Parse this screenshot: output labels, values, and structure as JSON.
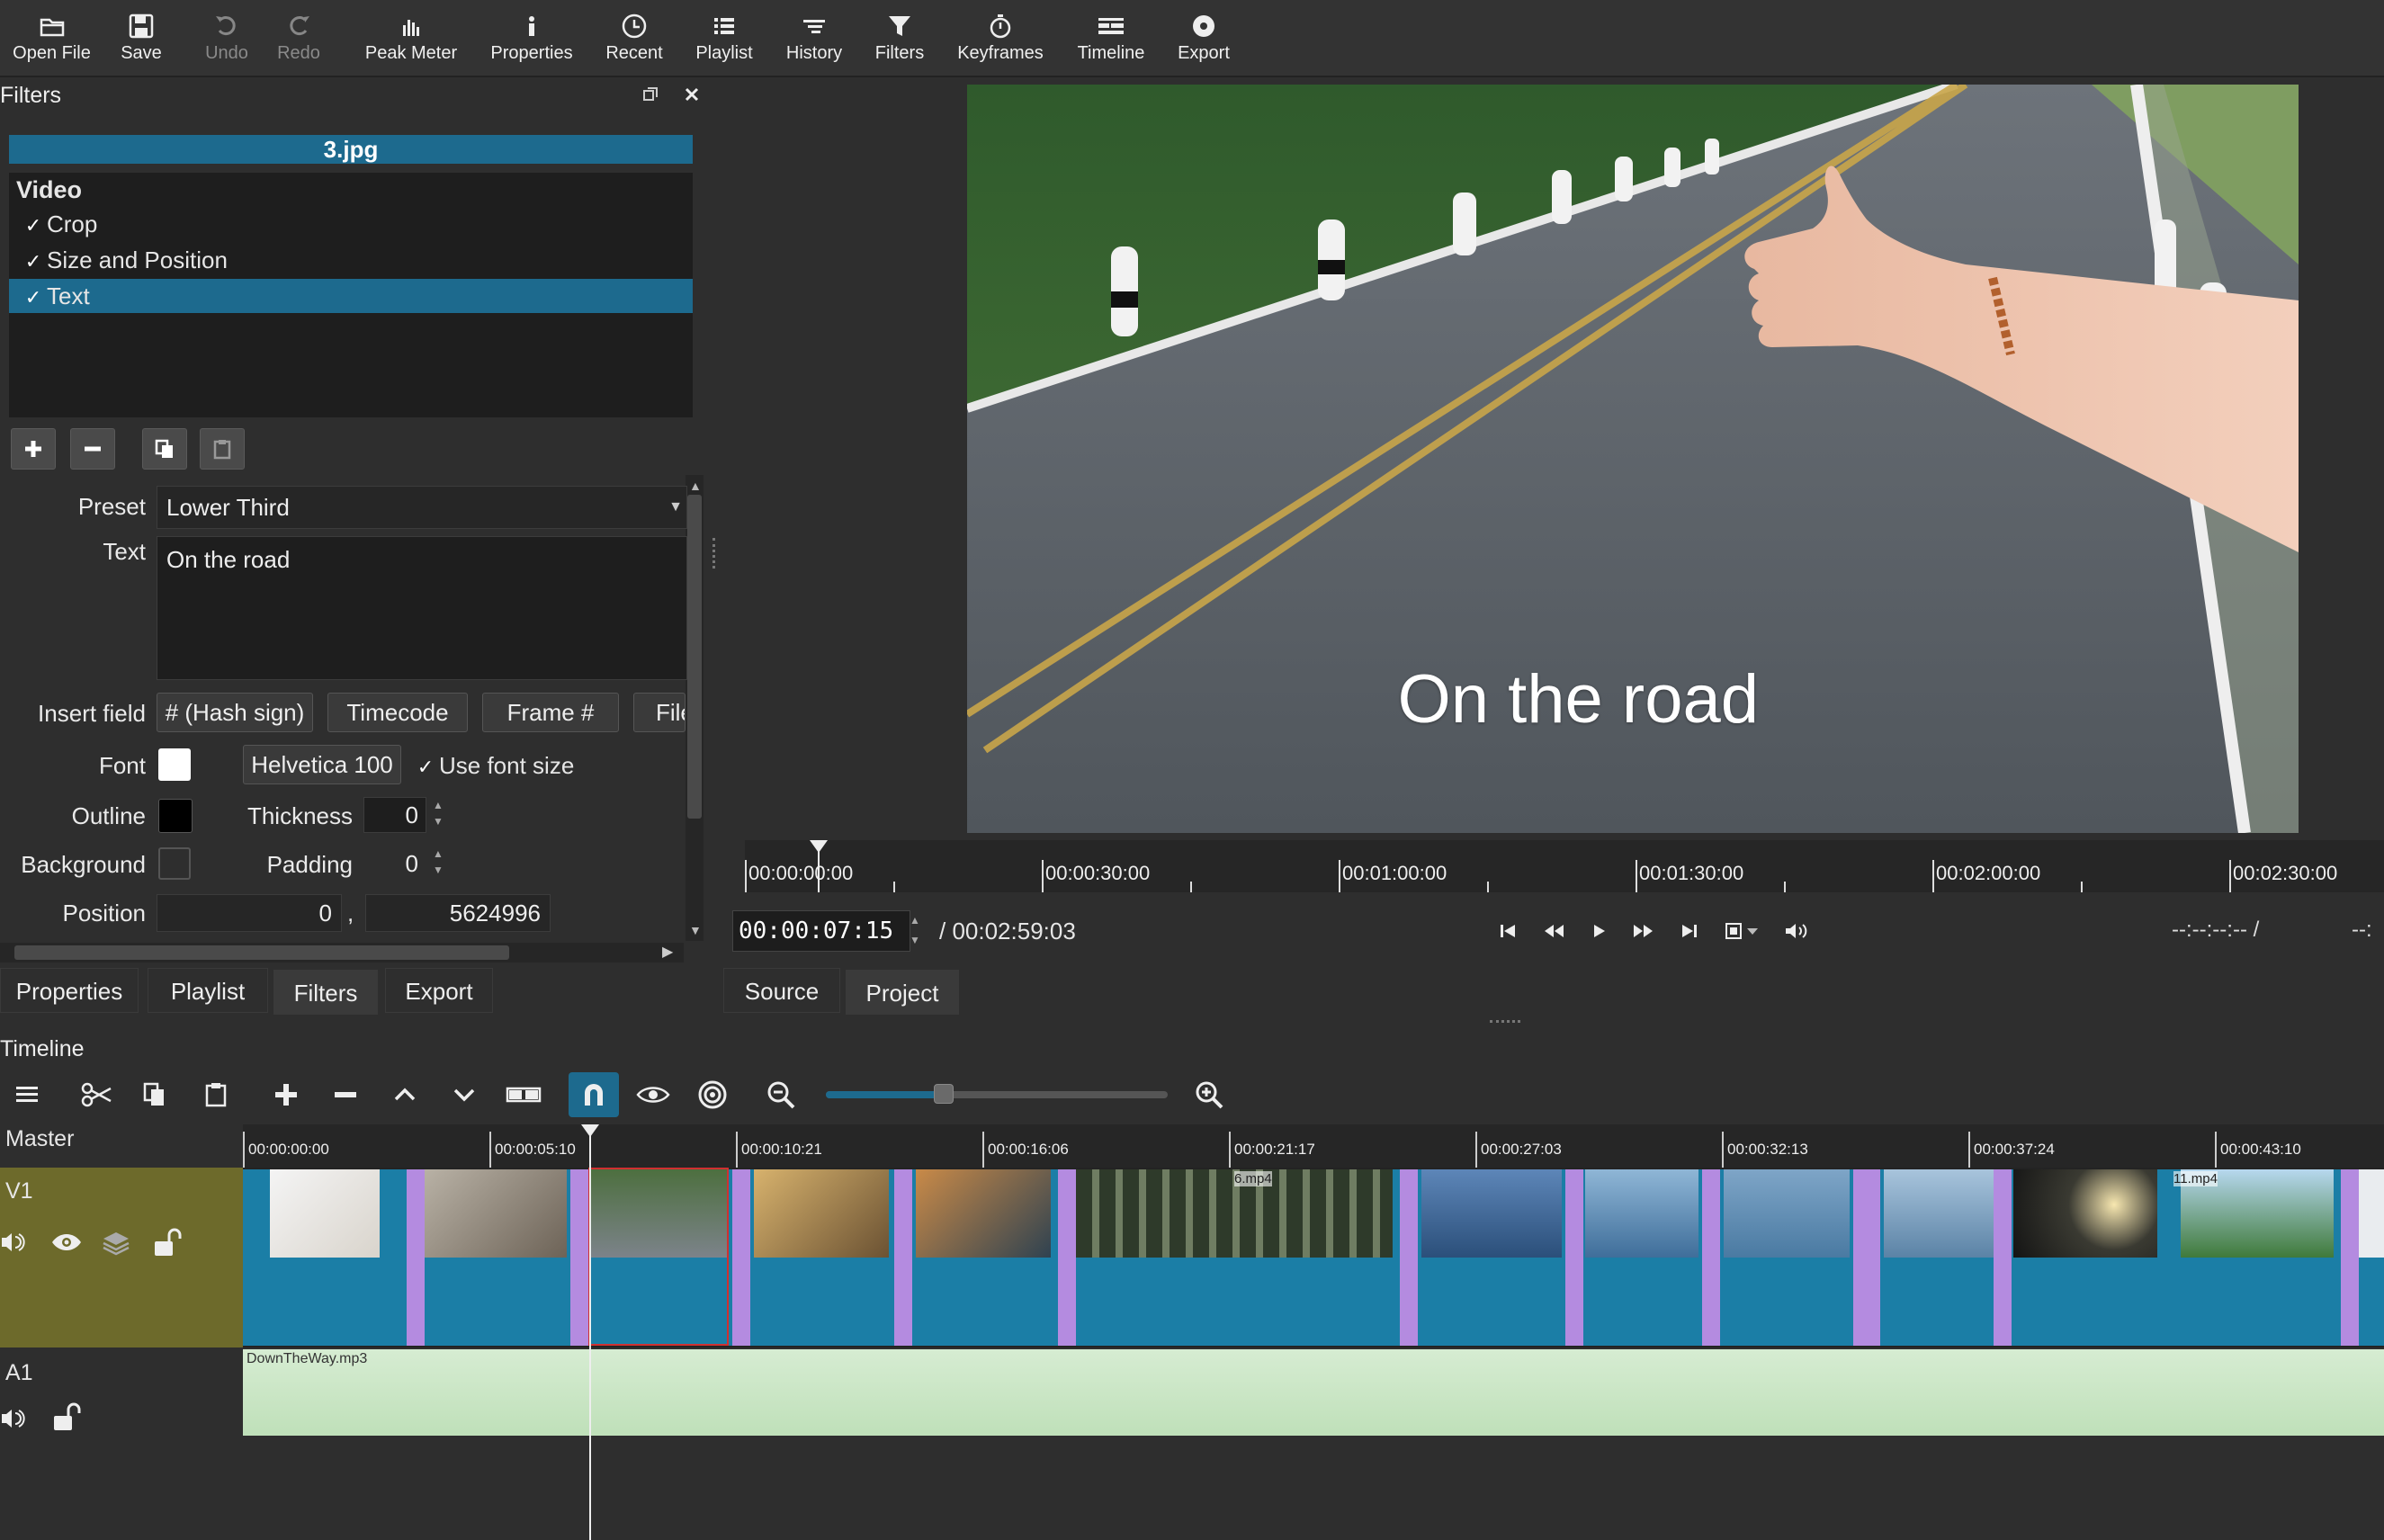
{
  "toolbar": {
    "items": [
      {
        "label": "Open File",
        "icon": "folder-icon"
      },
      {
        "label": "Save",
        "icon": "save-icon"
      },
      {
        "label": "Undo",
        "icon": "undo-icon",
        "disabled": true
      },
      {
        "label": "Redo",
        "icon": "redo-icon",
        "disabled": true
      },
      {
        "label": "Peak Meter",
        "icon": "peak-meter-icon"
      },
      {
        "label": "Properties",
        "icon": "info-icon"
      },
      {
        "label": "Recent",
        "icon": "clock-icon"
      },
      {
        "label": "Playlist",
        "icon": "list-icon"
      },
      {
        "label": "History",
        "icon": "history-icon"
      },
      {
        "label": "Filters",
        "icon": "funnel-icon"
      },
      {
        "label": "Keyframes",
        "icon": "stopwatch-icon"
      },
      {
        "label": "Timeline",
        "icon": "timeline-icon"
      },
      {
        "label": "Export",
        "icon": "export-icon"
      }
    ]
  },
  "filters": {
    "title": "Filters",
    "clip_name": "3.jpg",
    "group": "Video",
    "items": [
      {
        "label": "Crop",
        "checked": true
      },
      {
        "label": "Size and Position",
        "checked": true
      },
      {
        "label": "Text",
        "checked": true,
        "selected": true
      }
    ],
    "preset_label": "Preset",
    "preset_value": "Lower Third",
    "text_label": "Text",
    "text_value": "On the road",
    "insert_field_label": "Insert field",
    "insert_buttons": [
      "# (Hash sign)",
      "Timecode",
      "Frame #",
      "File"
    ],
    "font_label": "Font",
    "font_value": "Helvetica 100",
    "use_font_size": "Use font size",
    "outline_label": "Outline",
    "thickness_label": "Thickness",
    "thickness_value": "0",
    "background_label": "Background",
    "padding_label": "Padding",
    "padding_value": "0",
    "position_label": "Position",
    "position_x": "0",
    "position_sep": ",",
    "position_y": "5624996",
    "colors": {
      "font": "#ffffff",
      "outline": "#000000",
      "background": "transparent"
    }
  },
  "left_tabs": [
    "Properties",
    "Playlist",
    "Filters",
    "Export"
  ],
  "player": {
    "overlay_text": "On the road",
    "ruler": [
      "00:00:00:00",
      "00:00:30:00",
      "00:01:00:00",
      "00:01:30:00",
      "00:02:00:00",
      "00:02:30:00"
    ],
    "current_timecode": "00:00:07:15",
    "total_timecode": "/ 00:02:59:03",
    "in_out": "--:--:--:-- /",
    "in_out_right": "--:",
    "tabs": [
      "Source",
      "Project"
    ]
  },
  "timeline": {
    "title": "Timeline",
    "master_label": "Master",
    "ruler": [
      "00:00:00:00",
      "00:00:05:10",
      "00:00:10:21",
      "00:00:16:06",
      "00:00:21:17",
      "00:00:27:03",
      "00:00:32:13",
      "00:00:37:24",
      "00:00:43:10"
    ],
    "tracks": [
      {
        "name": "V1"
      },
      {
        "name": "A1"
      }
    ],
    "clip_labels": [
      "6.mp4",
      "11.mp4"
    ],
    "audio_clip": "DownTheWay.mp3"
  },
  "accent": "#1d6a8e"
}
